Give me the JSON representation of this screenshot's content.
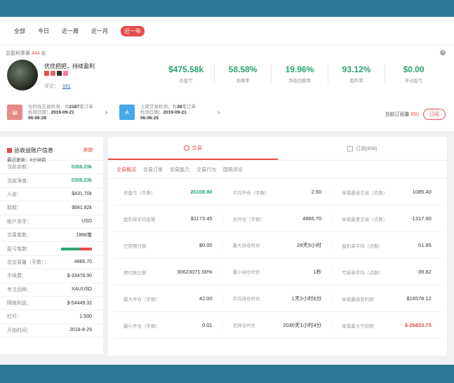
{
  "filters": [
    "全部",
    "今日",
    "近一周",
    "近一月",
    "近一年"
  ],
  "profile": {
    "rule_label": "总盈利率第",
    "rule_rank": "444",
    "rule_suffix": "名",
    "name": "优优把把，持续盈利",
    "rating_label": "评论：",
    "rating_count": "161"
  },
  "stats": [
    {
      "value": "$475.58k",
      "label": "总盈亏"
    },
    {
      "value": "58.58%",
      "label": "准确率"
    },
    {
      "value": "19.96%",
      "label": "净值回撤率"
    },
    {
      "value": "93.12%",
      "label": "盈利率"
    },
    {
      "value": "$0.00",
      "label": "浮动盈亏"
    }
  ],
  "report1": {
    "line1": "全时段交易检测，共",
    "count": "2187",
    "line1b": "笔订单",
    "line2": "检测日期：",
    "date": "2019-09-21",
    "time": "06:06:28"
  },
  "report2": {
    "line1": "上周交易检测，共",
    "count": "39",
    "line1b": "笔订单",
    "line2": "检测日期：",
    "date": "2019-09-21",
    "time": "06:06:25"
  },
  "orders": {
    "label": "当前订阅量",
    "count": "650",
    "button": "订阅"
  },
  "account": {
    "title": "总收益账户信息",
    "refresh": "刷新",
    "updated": "最近更新：6分钟前",
    "rows": [
      {
        "k": "当前余额：",
        "v": "5306.23k",
        "g": true
      },
      {
        "k": "当前净值：",
        "v": "5306.23k",
        "g": true
      },
      {
        "k": "入金：",
        "v": "$431.70k"
      },
      {
        "k": "取款：",
        "v": "$681.82k"
      },
      {
        "k": "账户货币：",
        "v": "USD"
      },
      {
        "k": "交易笔数：",
        "v": "1866笔"
      },
      {
        "k": "盈亏笔数：",
        "v": "",
        "bar": true
      },
      {
        "k": "总交易量（手数）：",
        "v": "4866.70"
      },
      {
        "k": "手续费：",
        "v": "$-33478.90"
      },
      {
        "k": "专注品种：",
        "v": "XAUUSD"
      },
      {
        "k": "隔夜利息：",
        "v": "$-54449.32"
      },
      {
        "k": "杠杆：",
        "v": "1:500"
      },
      {
        "k": "开始时间：",
        "v": "2018-8-29"
      }
    ]
  },
  "main_tabs": [
    {
      "label": "交易",
      "active": true
    },
    {
      "label": "订阅(658)",
      "active": false
    }
  ],
  "sub_tabs": [
    "交易概况",
    "交易订单",
    "交易能力",
    "交易行为",
    "围观评论"
  ],
  "metrics": [
    [
      {
        "k": "总盈亏（手数）",
        "v": "26108.80",
        "s": "grn"
      },
      {
        "k": "平均开仓（手数）",
        "v": "2.60"
      },
      {
        "k": "单笔最佳交易（点数）",
        "v": "1085.40"
      }
    ],
    [
      {
        "k": "盈利单平均金额",
        "v": "$1173.45"
      },
      {
        "k": "总开仓（手数）",
        "v": "4866.70"
      },
      {
        "k": "单笔最差交易（点数）",
        "v": "-1317.60"
      }
    ],
    [
      {
        "k": "已用预付款",
        "v": "$0.00"
      },
      {
        "k": "最大持仓时长",
        "v": "28天5小时"
      },
      {
        "k": "盈利单平均（点数）",
        "v": "51.85"
      }
    ],
    [
      {
        "k": "预付款比例",
        "v": "30623071.00%"
      },
      {
        "k": "最小持仓时长",
        "v": "1秒"
      },
      {
        "k": "亏损单平均（点数）",
        "v": "-39.82"
      }
    ],
    [
      {
        "k": "最大开仓（手数）",
        "v": "42.00"
      },
      {
        "k": "平均持仓时长",
        "v": "1天2小时6分"
      },
      {
        "k": "单笔最佳获利额",
        "v": "$16578.12"
      }
    ],
    [
      {
        "k": "最小开仓（手数）",
        "v": "0.01"
      },
      {
        "k": "总持仓时长",
        "v": "2030天1小时4分"
      },
      {
        "k": "单笔最大亏损额",
        "v": "$-26823.75",
        "s": "red"
      }
    ]
  ],
  "colors": {
    "accent": "#e84c4c",
    "positive": "#2aa56f",
    "frame": "#2a7896"
  }
}
